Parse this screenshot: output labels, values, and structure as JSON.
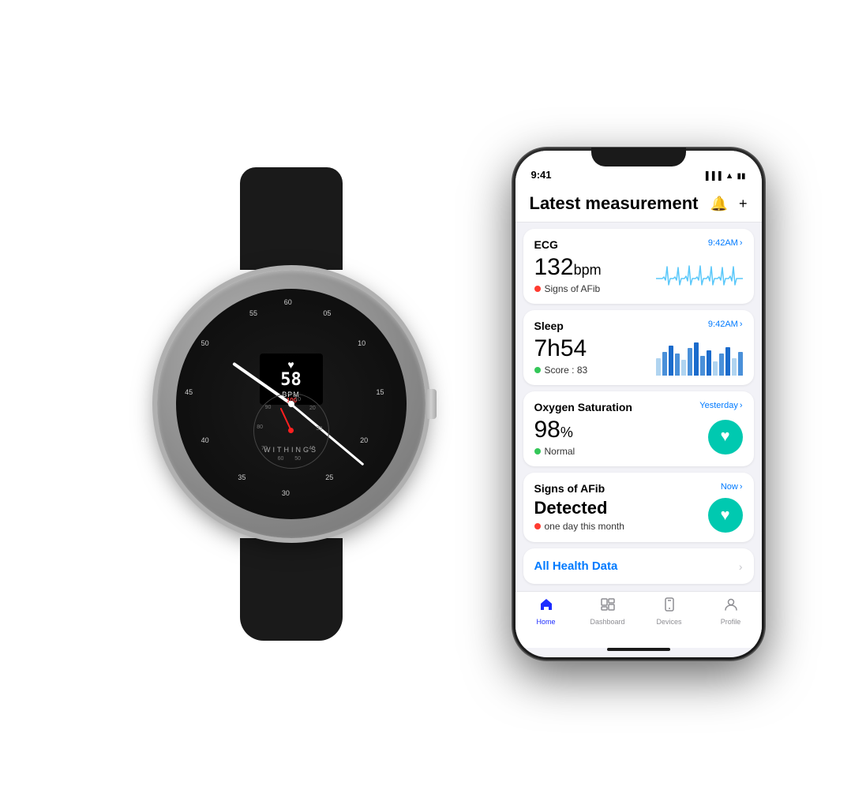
{
  "background": "#ffffff",
  "watch": {
    "brand": "WITHINGS",
    "bpm_value": "58",
    "bpm_label": "BPM",
    "sub_dial_numbers": [
      "100",
      "90",
      "80",
      "70",
      "60",
      "50",
      "40",
      "30",
      "20",
      "10"
    ],
    "spo2_highlight": "100",
    "dial_numbers": {
      "n60": "60",
      "n55": "55",
      "n50": "50",
      "n45": "45",
      "n40": "40",
      "n35": "35",
      "n30": "30",
      "n25": "25",
      "n20": "20",
      "n15": "15",
      "n10": "10",
      "n05": "05"
    }
  },
  "phone": {
    "status_bar": {
      "time": "9:41",
      "signal": "●●●",
      "wifi": "wifi",
      "battery": "battery"
    },
    "header": {
      "title": "Latest measurement",
      "bell_icon": "🔔",
      "plus_icon": "+"
    },
    "cards": {
      "ecg": {
        "title": "ECG",
        "time": "9:42AM",
        "value": "132",
        "unit": "bpm",
        "status_dot": "red",
        "status": "Signs of AFib"
      },
      "sleep": {
        "title": "Sleep",
        "time": "9:42AM",
        "value": "7h54",
        "status_dot": "green",
        "status": "Score : 83"
      },
      "oxygen": {
        "title": "Oxygen Saturation",
        "time": "Yesterday",
        "value": "98",
        "unit": "%",
        "status_dot": "green",
        "status": "Normal"
      },
      "afib": {
        "title": "Signs of AFib",
        "subtitle": "Detected",
        "time": "Now",
        "status_dot": "red",
        "status": "one day this month"
      }
    },
    "all_health": {
      "label": "All Health Data",
      "chevron": "›"
    },
    "tabs": {
      "home": {
        "label": "Home",
        "active": true
      },
      "dashboard": {
        "label": "Dashboard",
        "active": false
      },
      "devices": {
        "label": "Devices",
        "active": false
      },
      "profile": {
        "label": "Profile",
        "active": false
      }
    }
  }
}
